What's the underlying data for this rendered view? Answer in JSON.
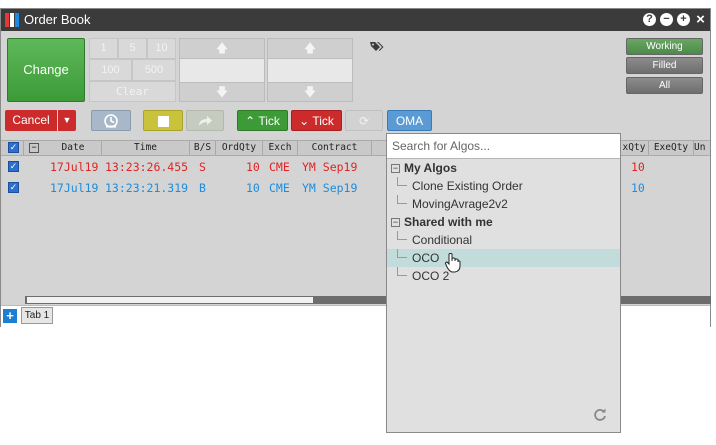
{
  "window": {
    "title": "Order Book"
  },
  "window_controls": {
    "help": "?",
    "minimize": "−",
    "add": "+",
    "close": "×"
  },
  "change_button": {
    "label": "Change"
  },
  "qty_pad": {
    "keys": [
      "1",
      "5",
      "10",
      "100",
      "500"
    ],
    "clear": "Clear"
  },
  "status_filters": [
    "Working",
    "Filled",
    "All"
  ],
  "toolbar": {
    "cancel": "Cancel",
    "tick_up": "Tick",
    "tick_down": "Tick",
    "oma": "OMA"
  },
  "grid": {
    "columns": [
      "Date",
      "Time",
      "B/S",
      "OrdQty",
      "Exch",
      "Contract"
    ],
    "right_columns": [
      "xQty",
      "ExeQty",
      "Un"
    ],
    "rows": [
      {
        "date": "17Jul19",
        "time": "13:23:26.455",
        "bs": "S",
        "qty": "10",
        "exch": "CME",
        "contract": "YM Sep19",
        "exqty": "10",
        "color": "#e02424"
      },
      {
        "date": "17Jul19",
        "time": "13:23:21.319",
        "bs": "B",
        "qty": "10",
        "exch": "CME",
        "contract": "YM Sep19",
        "exqty": "10",
        "color": "#1a8de0"
      }
    ]
  },
  "tabs": {
    "items": [
      "Tab 1"
    ],
    "add": "+"
  },
  "algo_panel": {
    "search_placeholder": "Search for Algos...",
    "groups": [
      {
        "name": "My Algos",
        "items": [
          "Clone Existing Order",
          "MovingAvrage2v2"
        ]
      },
      {
        "name": "Shared with me",
        "items": [
          "Conditional",
          "OCO",
          "OCO 2"
        ]
      }
    ],
    "highlighted": "OCO"
  },
  "colors": {
    "accent": "#5a9bd5",
    "buy": "#1a8de0",
    "sell": "#e02424",
    "change": "#3c9b37",
    "cancel": "#cc2b2b"
  }
}
